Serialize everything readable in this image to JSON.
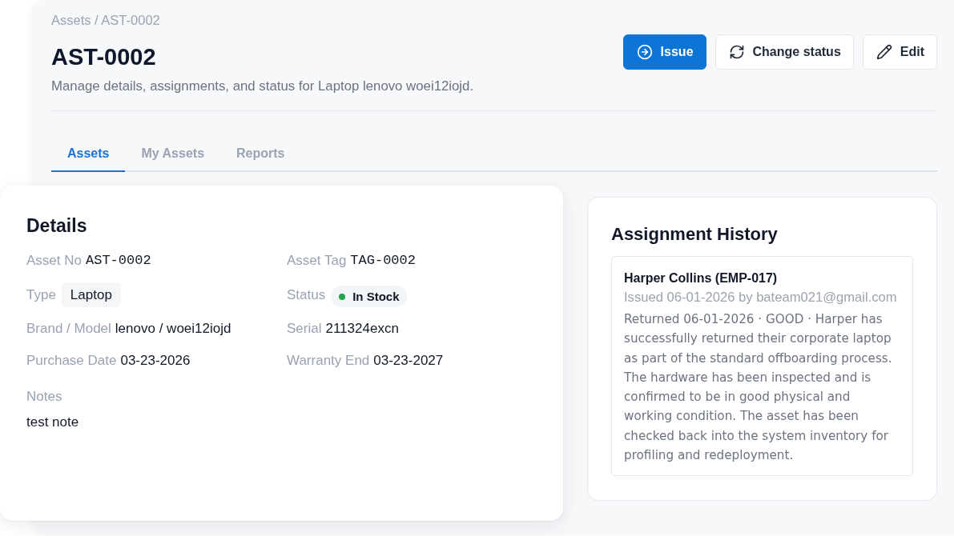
{
  "breadcrumb": "Assets / AST-0002",
  "header": {
    "title": "AST-0002",
    "subtitle": "Manage details, assignments, and status for Laptop lenovo woei12iojd."
  },
  "actions": [
    {
      "label": "Issue",
      "kind": "primary"
    },
    {
      "label": "Change status",
      "kind": "secondary"
    },
    {
      "label": "Edit",
      "kind": "secondary"
    }
  ],
  "tabs": [
    {
      "label": "Assets",
      "selected": true
    },
    {
      "label": "My Assets",
      "selected": false
    },
    {
      "label": "Reports",
      "selected": false
    }
  ],
  "details": {
    "title": "Details",
    "fields": [
      {
        "label": "Asset No",
        "value": "AST-0002",
        "kind": "mono"
      },
      {
        "label": "Asset Tag",
        "value": "TAG-0002",
        "kind": "mono"
      },
      {
        "label": "Type",
        "value": "Laptop",
        "kind": "chip"
      },
      {
        "label": "Status",
        "value": "In Stock",
        "kind": "status",
        "color": "#22a34a"
      },
      {
        "label": "Brand / Model",
        "value": "lenovo / woei12iojd",
        "kind": "text"
      },
      {
        "label": "Serial",
        "value": "211324excn",
        "kind": "text"
      },
      {
        "label": "Purchase Date",
        "value": "03-23-2026",
        "kind": "text"
      },
      {
        "label": "Warranty End",
        "value": "03-23-2027",
        "kind": "text"
      }
    ],
    "notes": {
      "label": "Notes",
      "value": "test note"
    }
  },
  "history": {
    "title": "Assignment History",
    "entries": [
      {
        "name": "Harper Collins (EMP-017)",
        "issued": "Issued 06-01-2026 by bateam021@gmail.com",
        "returned": "Returned 06-01-2026 · GOOD · Harper has successfully returned their corporate laptop as part of the standard offboarding process. The hardware has been inspected and is confirmed to be in good physical and working condition. The asset has been checked back into the system inventory for profiling and redeployment."
      }
    ]
  }
}
